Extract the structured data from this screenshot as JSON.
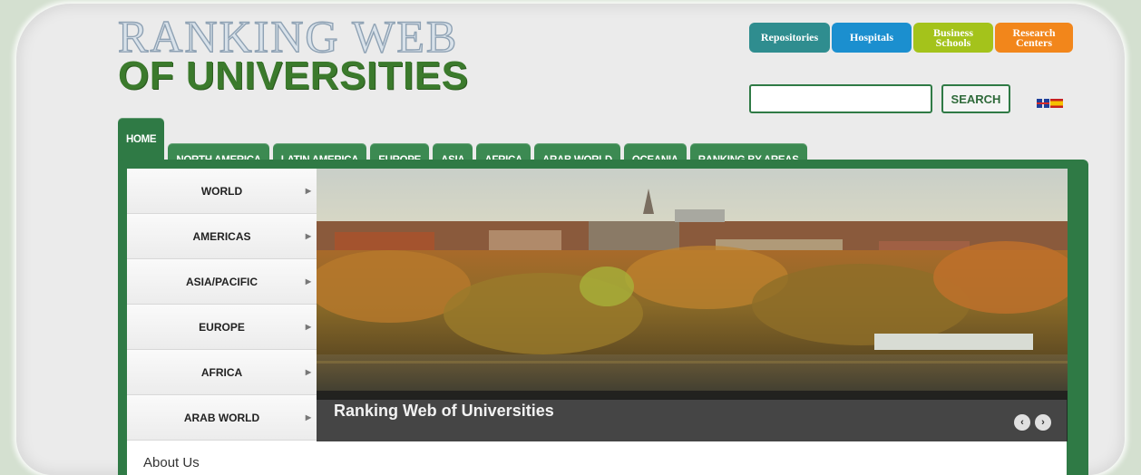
{
  "logo": {
    "line1": "RANKING WEB",
    "line2": "OF UNIVERSITIES"
  },
  "top_buttons": [
    {
      "label": "Repositories",
      "color": "#2f8d8f"
    },
    {
      "label": "Hospitals",
      "color": "#1b8fcf"
    },
    {
      "label": "Business\nSchools",
      "color": "#a4c31b"
    },
    {
      "label": "Research\nCenters",
      "color": "#f2861b"
    }
  ],
  "search": {
    "value": "",
    "button_label": "SEARCH"
  },
  "languages": [
    "uk-flag-icon",
    "es-flag-icon"
  ],
  "nav_tabs": [
    "HOME",
    "NORTH AMERICA",
    "LATIN AMERICA",
    "EUROPE",
    "ASIA",
    "AFRICA",
    "ARAB WORLD",
    "OCEANIA",
    "RANKING BY AREAS"
  ],
  "sidebar_menu": [
    "WORLD",
    "AMERICAS",
    "ASIA/PACIFIC",
    "EUROPE",
    "AFRICA",
    "ARAB WORLD"
  ],
  "hero": {
    "caption": "Ranking Web of Universities",
    "prev": "‹",
    "next": "›"
  },
  "about": "About Us",
  "colors": {
    "brand_green": "#2f7a45",
    "tab_green": "#3c8a52"
  }
}
